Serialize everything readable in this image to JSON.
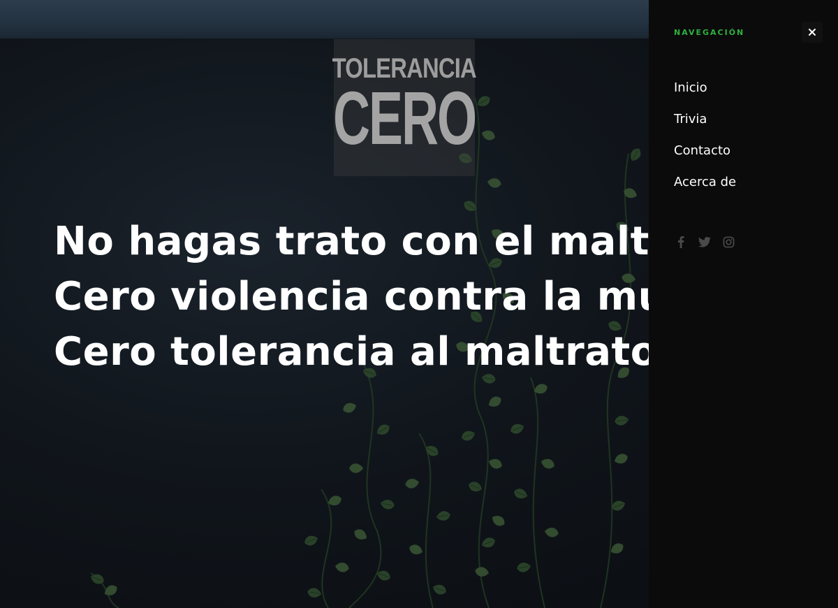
{
  "hero": {
    "logo": {
      "top_word": "TOLERANCIA",
      "bottom_word": "CERO"
    },
    "headline": [
      "No hagas trato con el maltrato.",
      "Cero violencia contra la mujer.",
      "Cero tolerancia al maltrato."
    ]
  },
  "nav_panel": {
    "heading": "NAVEGACIÓN",
    "close_icon": "close-icon",
    "items": [
      {
        "label": "Inicio"
      },
      {
        "label": "Trivia"
      },
      {
        "label": "Contacto"
      },
      {
        "label": "Acerca de"
      }
    ],
    "socials": [
      "facebook-icon",
      "twitter-icon",
      "instagram-icon"
    ]
  },
  "colors": {
    "accent": "#2fb13f",
    "panel_bg": "#0b0b0b",
    "text": "#ffffff"
  }
}
